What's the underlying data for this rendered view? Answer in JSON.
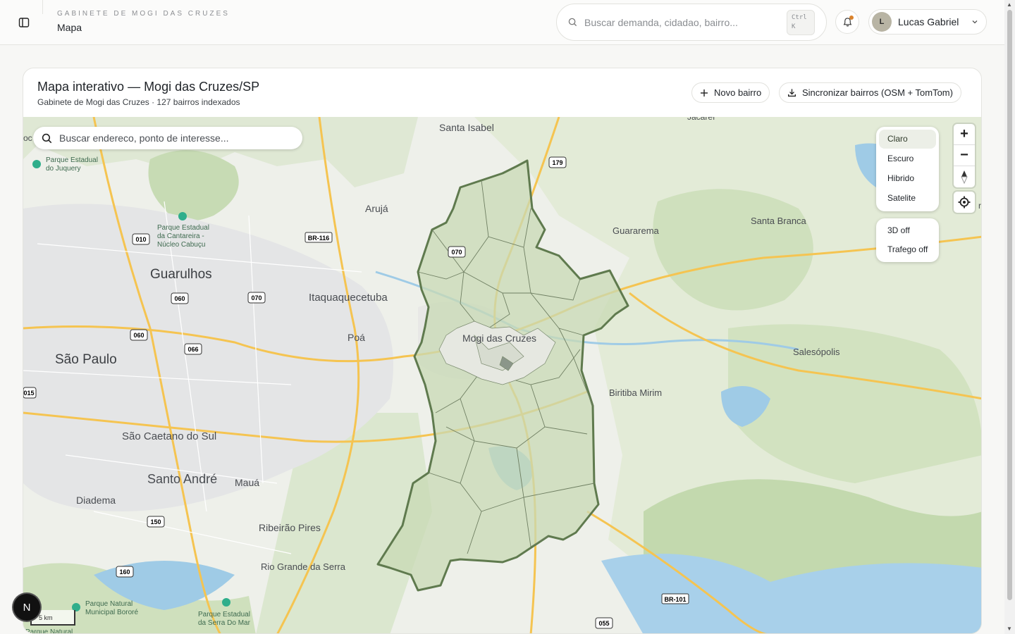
{
  "header": {
    "org_label": "GABINETE DE MOGI DAS CRUZES",
    "page_title": "Mapa",
    "search_placeholder": "Buscar demanda, cidadao, bairro...",
    "shortcut_ctrl": "Ctrl",
    "shortcut_key": "K",
    "user_initial": "L",
    "user_name": "Lucas Gabriel"
  },
  "card": {
    "title": "Mapa interativo — Mogi das Cruzes/SP",
    "subtitle": "Gabinete de Mogi das Cruzes · 127 bairros indexados",
    "new_button": "Novo bairro",
    "sync_button": "Sincronizar bairros (OSM + TomTom)"
  },
  "map": {
    "search_placeholder": "Buscar endereco, ponto de interesse...",
    "styles": [
      "Claro",
      "Escuro",
      "Hibrido",
      "Satelite"
    ],
    "active_style": "Claro",
    "toggles": [
      "3D off",
      "Trafego off"
    ],
    "zoom_in": "+",
    "zoom_out": "−",
    "scale": "5 km",
    "places": [
      {
        "name": "Santa Isabel"
      },
      {
        "name": "Jacareí"
      },
      {
        "name": "Arujá"
      },
      {
        "name": "Guararema"
      },
      {
        "name": "Santa Branca"
      },
      {
        "name": "Guarulhos"
      },
      {
        "name": "Itaquaquecetuba"
      },
      {
        "name": "Poá"
      },
      {
        "name": "Mogi das Cruzes"
      },
      {
        "name": "São Paulo"
      },
      {
        "name": "Salesópolis"
      },
      {
        "name": "Biritiba Mirim"
      },
      {
        "name": "São Caetano do Sul"
      },
      {
        "name": "Santo André"
      },
      {
        "name": "Mauá"
      },
      {
        "name": "Diadema"
      },
      {
        "name": "Ribeirão Pires"
      },
      {
        "name": "Rio Grande da Serra"
      }
    ],
    "parks": [
      {
        "name": "Parque Estadual do Juquery"
      },
      {
        "name": "Parque Estadual da Cantareira - Núcleo Cabuçu"
      },
      {
        "name": "Parque Natural Municipal Bororé"
      },
      {
        "name": "Parque Estadual da Serra Do Mar"
      },
      {
        "name": "Parque Natural"
      }
    ],
    "shields": [
      "179",
      "BR-116",
      "010",
      "070",
      "060",
      "070",
      "060",
      "066",
      "015",
      "150",
      "160",
      "BR-101",
      "055"
    ]
  },
  "badge": "N",
  "colors": {
    "accent_dot": "#d9822b",
    "district_fill": "#c8d9b4",
    "district_border": "#5f7a4e",
    "water": "#9fcbe6",
    "road": "#f5c451"
  }
}
